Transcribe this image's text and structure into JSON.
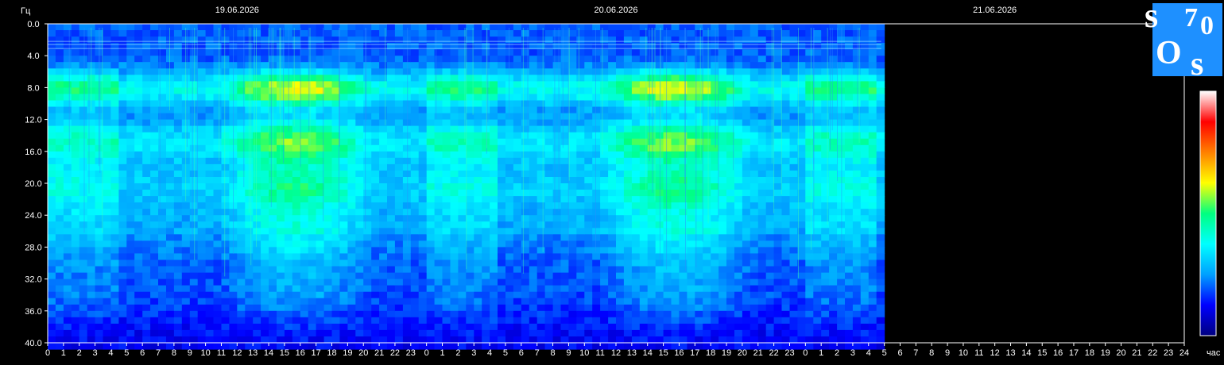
{
  "chart_data": {
    "type": "heatmap",
    "y_unit_label": "Гц",
    "x_unit_label": "час",
    "ylim": [
      0,
      40
    ],
    "y_ticks": [
      "0.0",
      "4.0",
      "8.0",
      "12.0",
      "16.0",
      "20.0",
      "24.0",
      "28.0",
      "32.0",
      "36.0",
      "40.0"
    ],
    "x_ticks": [
      "0",
      "1",
      "2",
      "3",
      "4",
      "5",
      "6",
      "7",
      "8",
      "9",
      "10",
      "11",
      "12",
      "13",
      "14",
      "15",
      "16",
      "17",
      "18",
      "19",
      "20",
      "21",
      "22",
      "23",
      "0",
      "1",
      "2",
      "3",
      "4",
      "5",
      "6",
      "7",
      "8",
      "9",
      "10",
      "11",
      "12",
      "13",
      "14",
      "15",
      "16",
      "17",
      "18",
      "19",
      "20",
      "21",
      "22",
      "23",
      "0",
      "1",
      "2",
      "3",
      "4",
      "5",
      "6",
      "7",
      "8",
      "9",
      "10",
      "11",
      "12",
      "13",
      "14",
      "15",
      "16",
      "17",
      "18",
      "19",
      "20",
      "21",
      "22",
      "23",
      "24"
    ],
    "dates": [
      "19.06.2026",
      "20.06.2026",
      "21.06.2026"
    ],
    "xlim_hours": [
      0,
      72
    ],
    "data_end_hour": 52.8,
    "resonance_bands_hz": [
      7.8,
      14.3,
      20.0,
      26.0,
      33.0
    ],
    "colorscale": [
      "#000080",
      "#0000ff",
      "#00a0ff",
      "#00ffff",
      "#00ff80",
      "#ffff00",
      "#ff8000",
      "#ff0000",
      "#ffffff"
    ]
  },
  "logo": {
    "letters": [
      "s",
      "7",
      "0",
      "O",
      "s"
    ]
  }
}
